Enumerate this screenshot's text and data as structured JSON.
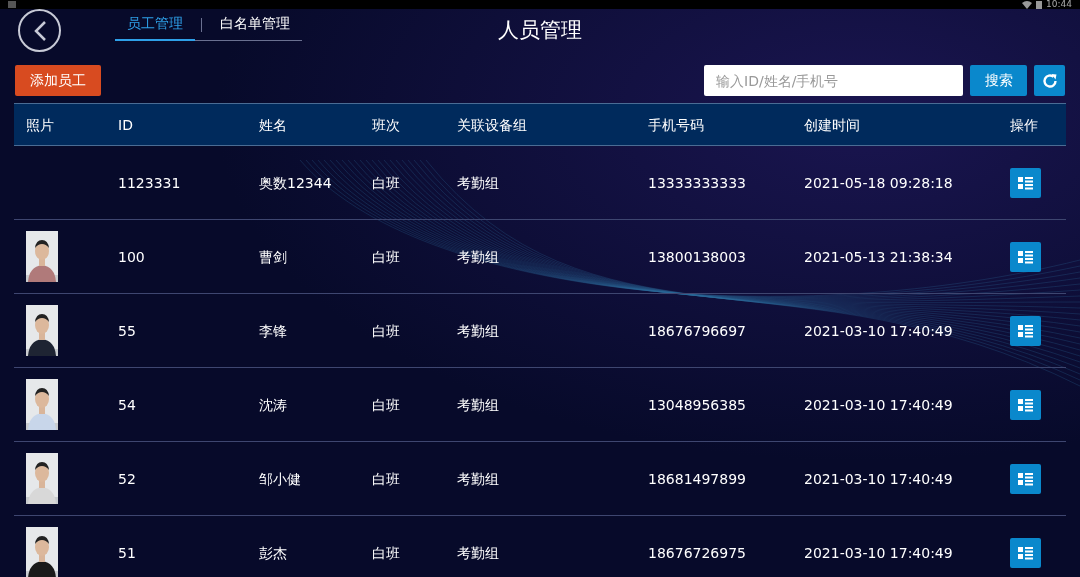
{
  "status_bar": {
    "time": "10:44"
  },
  "header": {
    "title": "人员管理",
    "tabs": [
      {
        "label": "员工管理",
        "selected": true
      },
      {
        "label": "白名单管理",
        "selected": false
      }
    ]
  },
  "toolbar": {
    "add_button": "添加员工",
    "search": {
      "placeholder": "输入ID/姓名/手机号"
    },
    "search_button": "搜索"
  },
  "table": {
    "columns": [
      "照片",
      "ID",
      "姓名",
      "班次",
      "关联设备组",
      "手机号码",
      "创建时间",
      "操作"
    ],
    "rows": [
      {
        "id": "1123331",
        "name": "奥数12344",
        "shift": "白班",
        "group": "考勤组",
        "phone": "13333333333",
        "created": "2021-05-18 09:28:18"
      },
      {
        "id": "100",
        "name": "曹剑",
        "shift": "白班",
        "group": "考勤组",
        "phone": "13800138003",
        "created": "2021-05-13 21:38:34"
      },
      {
        "id": "55",
        "name": "李锋",
        "shift": "白班",
        "group": "考勤组",
        "phone": "18676796697",
        "created": "2021-03-10 17:40:49"
      },
      {
        "id": "54",
        "name": "沈涛",
        "shift": "白班",
        "group": "考勤组",
        "phone": "13048956385",
        "created": "2021-03-10 17:40:49"
      },
      {
        "id": "52",
        "name": "邹小健",
        "shift": "白班",
        "group": "考勤组",
        "phone": "18681497899",
        "created": "2021-03-10 17:40:49"
      },
      {
        "id": "51",
        "name": "彭杰",
        "shift": "白班",
        "group": "考勤组",
        "phone": "18676726975",
        "created": "2021-03-10 17:40:49"
      }
    ]
  }
}
